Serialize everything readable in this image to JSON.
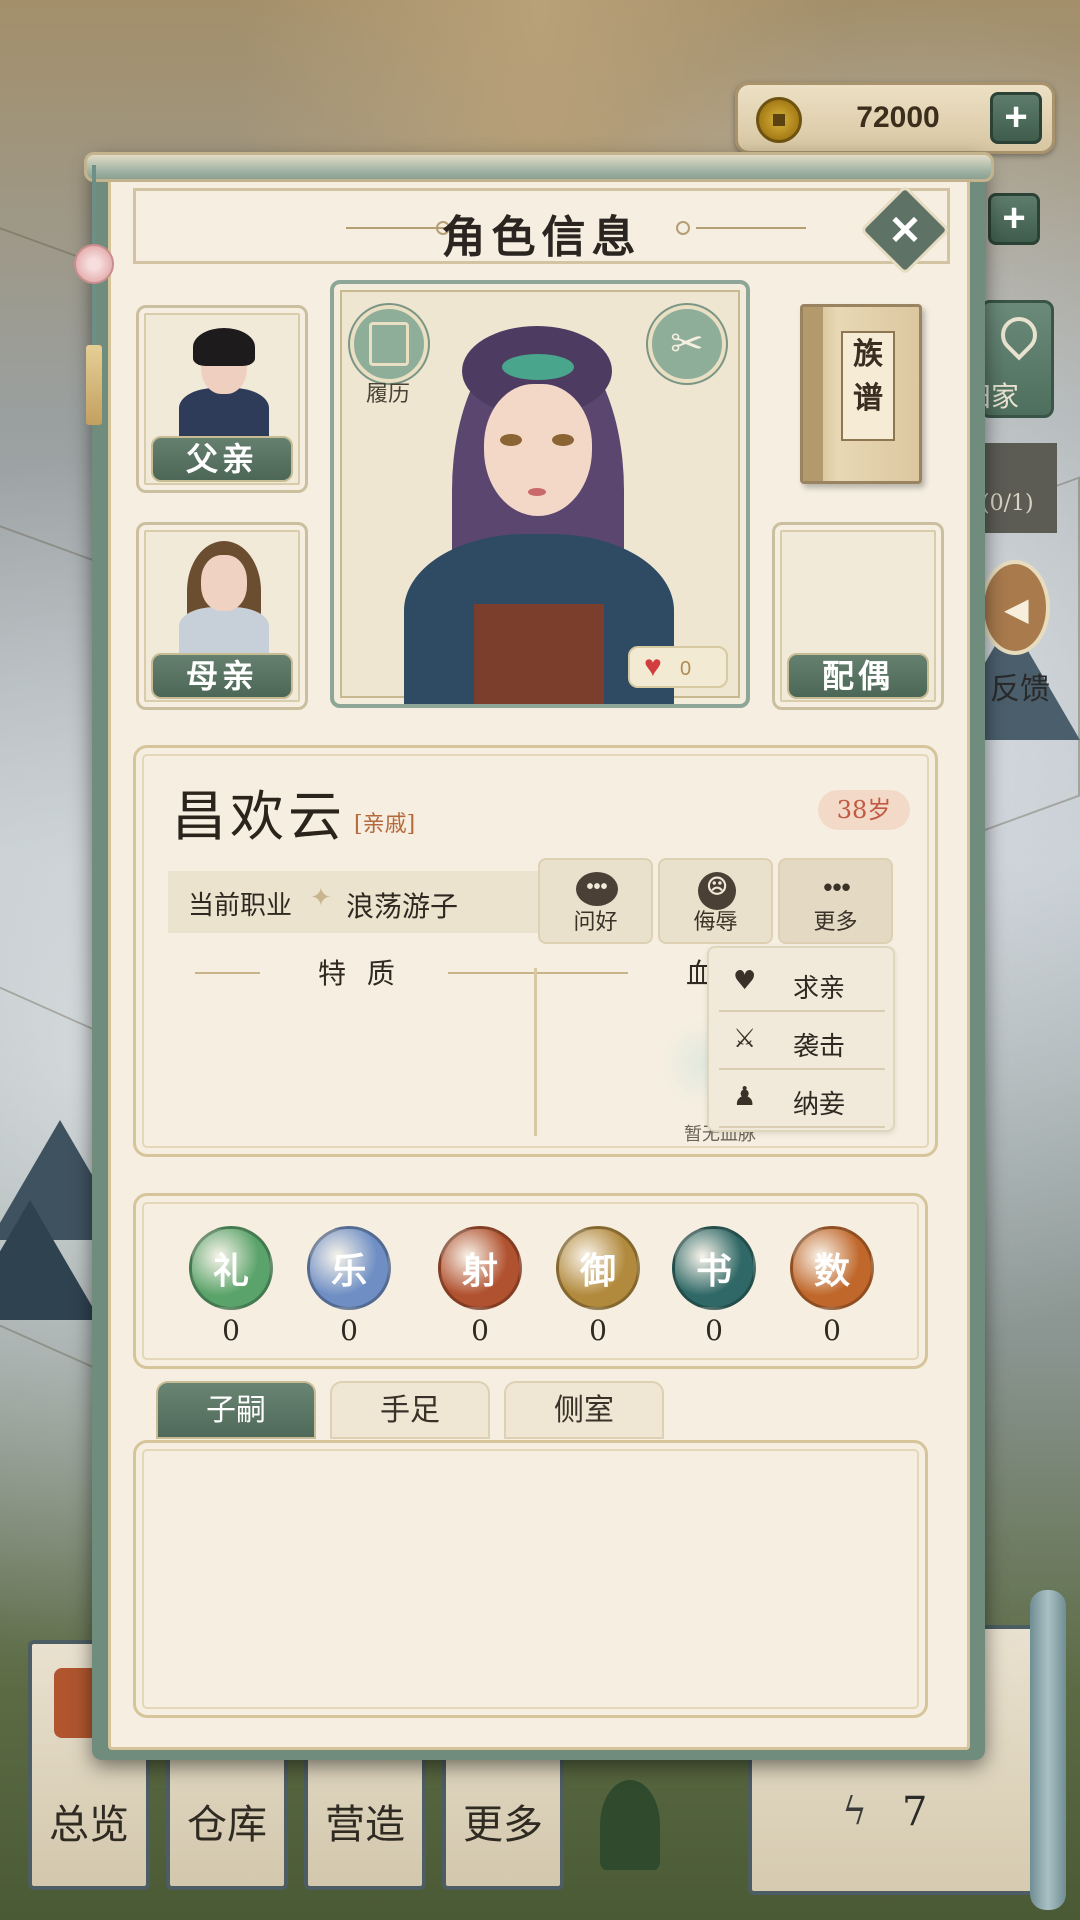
{
  "resources": {
    "coins": "72000",
    "plus_symbol": "+"
  },
  "side": {
    "home_label": "归家",
    "quest_count": "(0/1)",
    "feedback_label": "反馈"
  },
  "bottom_nav": {
    "overview": "总览",
    "warehouse": "仓库",
    "build": "营造",
    "more": "更多"
  },
  "bottom_right": {
    "energy_value": "7"
  },
  "panel": {
    "title": "角色信息",
    "close_symbol": "✕"
  },
  "family": {
    "father": "父亲",
    "mother": "母亲",
    "spouse": "配偶",
    "clan_book": "族谱"
  },
  "portrait": {
    "resume_label": "履历",
    "affection": "0"
  },
  "character": {
    "name": "昌欢云",
    "relation": "[亲戚]",
    "age": "38岁",
    "job_label": "当前职业",
    "job_value": "浪荡游子",
    "trait_title": "特 质",
    "bloodline_title": "血",
    "bloodline_empty": "暂无血脉"
  },
  "actions": {
    "greet": "问好",
    "insult": "侮辱",
    "more": "更多",
    "greet_icon": "•••",
    "more_icon": "•••"
  },
  "dropdown": [
    {
      "label": "求亲",
      "icon": "heart-icon",
      "glyph": "♥"
    },
    {
      "label": "袭击",
      "icon": "crossed-swords-icon",
      "glyph": "⚔"
    },
    {
      "label": "纳妾",
      "icon": "kneeling-person-icon",
      "glyph": "♟"
    }
  ],
  "skills": [
    {
      "name": "礼",
      "value": "0",
      "color": "#5aa36a"
    },
    {
      "name": "乐",
      "value": "0",
      "color": "#6f8fc4"
    },
    {
      "name": "射",
      "value": "0",
      "color": "#b0512f"
    },
    {
      "name": "御",
      "value": "0",
      "color": "#b28a3e"
    },
    {
      "name": "书",
      "value": "0",
      "color": "#2f6866"
    },
    {
      "name": "数",
      "value": "0",
      "color": "#c0682c"
    }
  ],
  "tabs": [
    {
      "label": "子嗣",
      "active": true
    },
    {
      "label": "手足",
      "active": false
    },
    {
      "label": "侧室",
      "active": false
    }
  ]
}
